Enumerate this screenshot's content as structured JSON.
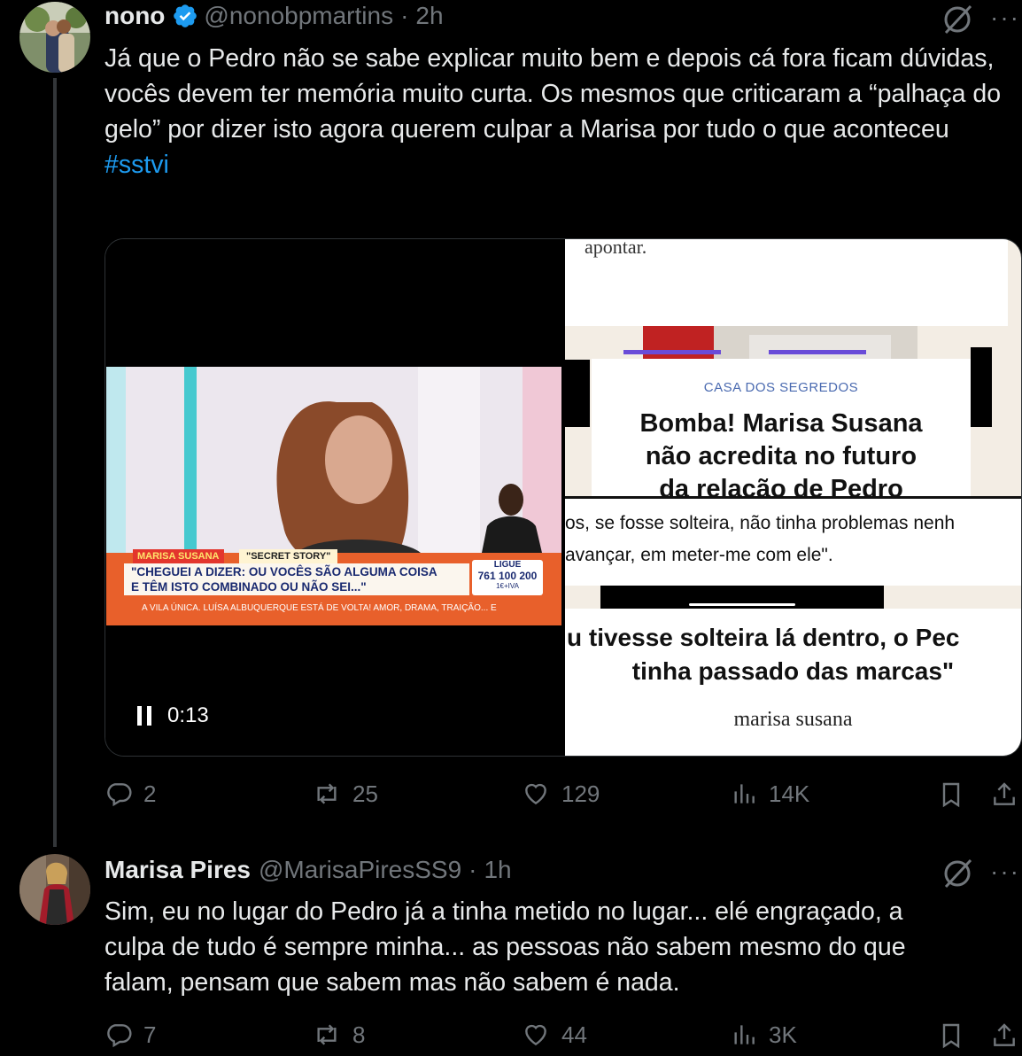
{
  "tweet1": {
    "name": "nono",
    "handle": "@nonobpmartins",
    "separator": "·",
    "time": "2h",
    "text": "Já que o Pedro não se sabe explicar muito bem e depois cá fora ficam dúvidas, vocês devem ter memória muito curta. Os mesmos que criticaram a “palhaça do gelo” por dizer isto agora querem culpar a Marisa por tudo o que aconteceu",
    "hashtag": "#sstvi",
    "more": "···",
    "video": {
      "tv_name": "MARISA SUSANA",
      "tv_show": "\"SECRET STORY\"",
      "tv_quote_line1": "\"CHEGUEI A DIZER: OU VOCÊS SÃO ALGUMA COISA",
      "tv_quote_line2": "E TÊM ISTO COMBINADO OU NÃO SEI...\"",
      "tv_ligue": "LIGUE",
      "tv_phone": "761 100 200",
      "tv_iva": "1€+IVA",
      "tv_ticker": "A VILA ÚNICA. LUÍSA ALBUQUERQUE ESTÁ DE VOLTA! AMOR, DRAMA, TRAIÇÃO... E",
      "time": "0:13",
      "art_top": "apontar.",
      "art_tag": "CASA DOS SEGREDOS",
      "art_headline1": "Bomba! Marisa Susana",
      "art_headline2": "não acredita no futuro",
      "art_headline3": "da relação de Pedro",
      "art_quote1": "os, se fosse solteira, não tinha problemas nenh",
      "art_quote2": "avançar, em meter-me com ele\".",
      "art_big1": "u tivesse solteira lá dentro, o Pec",
      "art_big2": "tinha passado das marcas\"",
      "art_sign": "marisa susana"
    },
    "actions": {
      "replies": "2",
      "reposts": "25",
      "likes": "129",
      "views": "14K"
    }
  },
  "tweet2": {
    "name": "Marisa Pires",
    "handle": "@MarisaPiresSS9",
    "separator": "·",
    "time": "1h",
    "more": "···",
    "text_line1": "Sim, eu no lugar do Pedro já a tinha metido no lugar... elé engraçado, a",
    "text_line2": "culpa de tudo é sempre minha... as pessoas não sabem mesmo do que",
    "text_line3": "falam, pensam que sabem mas não sabem é nada.",
    "actions": {
      "replies": "7",
      "reposts": "8",
      "likes": "44",
      "views": "3K"
    }
  },
  "colors": {
    "background": "#000000",
    "text": "#e7e9ea",
    "muted": "#71767b",
    "link": "#1d9bf0",
    "verified": "#1d9bf0"
  }
}
